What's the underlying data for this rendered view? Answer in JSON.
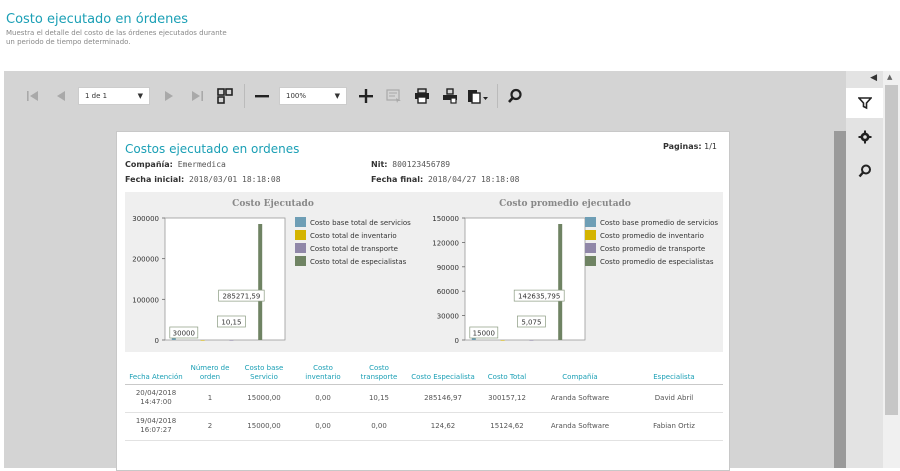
{
  "page": {
    "title": "Costo ejecutado en órdenes",
    "description": "Muestra el detalle del costo de las órdenes ejecutados durante un periodo de tiempo determinado."
  },
  "toolbar": {
    "page_select_value": "1 de 1",
    "zoom_value": "100%",
    "icons": [
      "first-page-icon",
      "prev-page-icon",
      "next-page-icon",
      "last-page-icon",
      "multi-page-icon",
      "zoom-out-icon",
      "zoom-in-icon",
      "highlight-icon",
      "print-icon",
      "print-page-icon",
      "export-icon",
      "search-icon"
    ]
  },
  "report": {
    "title": "Costos ejecutado en ordenes",
    "pages_label": "Paginas:",
    "pages_value": "1/1",
    "company_label": "Compañía:",
    "company_value": "Emermedica",
    "nit_label": "Nit:",
    "nit_value": "800123456789",
    "start_label": "Fecha inicial:",
    "start_value": "2018/03/01 18:18:08",
    "end_label": "Fecha final:",
    "end_value": "2018/04/27 18:18:08"
  },
  "chart_data": [
    {
      "type": "bar",
      "title": "Costo Ejecutado",
      "ylim": [
        0,
        300000
      ],
      "yticks": [
        0,
        100000,
        200000,
        300000
      ],
      "series": [
        {
          "name": "Costo base total de servicios",
          "color": "#6e9eb5",
          "values": [
            30000
          ],
          "label": "30000"
        },
        {
          "name": "Costo total de inventario",
          "color": "#d4b400",
          "values": [
            0
          ],
          "label": ""
        },
        {
          "name": "Costo total de transporte",
          "color": "#9087a8",
          "values": [
            10.15
          ],
          "label": "10,15"
        },
        {
          "name": "Costo total de especialistas",
          "color": "#6f8363",
          "values": [
            285271.59
          ],
          "label": "285271,59"
        }
      ]
    },
    {
      "type": "bar",
      "title": "Costo promedio ejecutado",
      "ylim": [
        0,
        150000
      ],
      "yticks": [
        0,
        30000,
        60000,
        90000,
        120000,
        150000
      ],
      "series": [
        {
          "name": "Costo base promedio de servicios",
          "color": "#6e9eb5",
          "values": [
            15000
          ],
          "label": "15000"
        },
        {
          "name": "Costo promedio de inventario",
          "color": "#d4b400",
          "values": [
            0
          ],
          "label": ""
        },
        {
          "name": "Costo promedio de transporte",
          "color": "#9087a8",
          "values": [
            5.075
          ],
          "label": "5,075"
        },
        {
          "name": "Costo promedio de especialistas",
          "color": "#6f8363",
          "values": [
            142635.795
          ],
          "label": "142635,795"
        }
      ]
    }
  ],
  "table": {
    "headers": [
      "Fecha Atención",
      "Número de orden",
      "Costo base Servicio",
      "Costo inventario",
      "Costo transporte",
      "Costo Especialista",
      "Costo Total",
      "Compañía",
      "Especialista"
    ],
    "rows": [
      [
        "20/04/2018 14:47:00",
        "1",
        "15000,00",
        "0,00",
        "10,15",
        "285146,97",
        "300157,12",
        "Aranda Software",
        "David Abril"
      ],
      [
        "19/04/2018 16:07:27",
        "2",
        "15000,00",
        "0,00",
        "0,00",
        "124,62",
        "15124,62",
        "Aranda Software",
        "Fabian Ortiz"
      ]
    ]
  },
  "side_panel": {
    "tabs": [
      "filter-icon",
      "gear-icon",
      "search-icon"
    ]
  },
  "colors": {
    "accent": "#1a9fb5",
    "viewer_bg": "#d4d4d4",
    "chart_bg": "#efefef"
  }
}
